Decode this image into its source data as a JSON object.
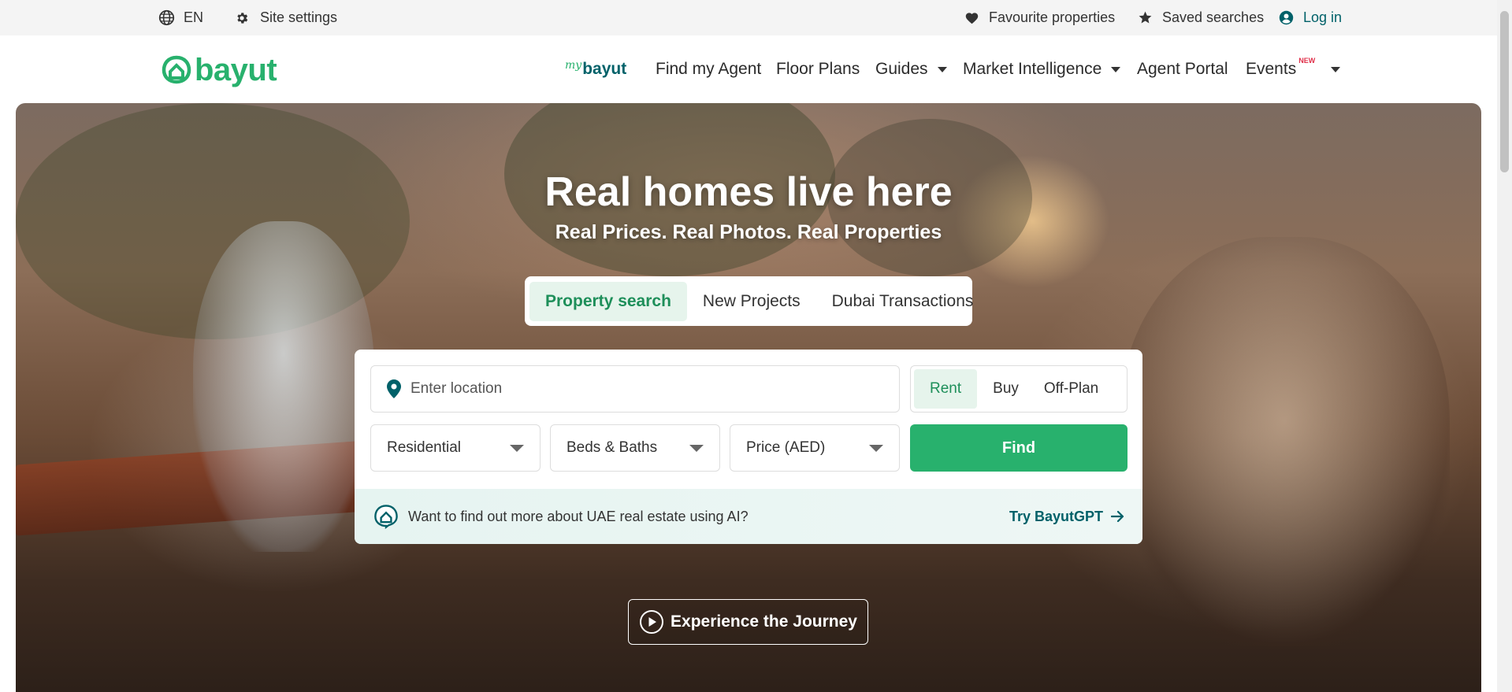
{
  "topbar": {
    "language": "EN",
    "site_settings": "Site settings",
    "favourites": "Favourite properties",
    "saved_searches": "Saved searches",
    "login": "Log in"
  },
  "nav": {
    "logo": "bayut",
    "mybayut_prefix": "my",
    "mybayut": "bayut",
    "find_agent": "Find my Agent",
    "floor_plans": "Floor Plans",
    "guides": "Guides",
    "market_intelligence": "Market Intelligence",
    "agent_portal": "Agent Portal",
    "events": "Events",
    "events_badge": "NEW"
  },
  "hero": {
    "title": "Real homes live here",
    "subtitle": "Real Prices. Real Photos. Real Properties",
    "tabs": [
      {
        "label": "Property search",
        "active": true
      },
      {
        "label": "New Projects",
        "active": false
      },
      {
        "label": "Dubai Transactions",
        "active": false
      }
    ],
    "search": {
      "location_placeholder": "Enter location",
      "purpose": [
        "Rent",
        "Buy",
        "Off-Plan"
      ],
      "purpose_selected": "Rent",
      "property_type": "Residential",
      "beds_baths": "Beds & Baths",
      "price": "Price (AED)",
      "find": "Find"
    },
    "ai_prompt": "Want to find out more about UAE real estate using AI?",
    "ai_link": "Try BayutGPT",
    "journey": "Experience the Journey"
  },
  "colors": {
    "brand_green": "#28b16d",
    "teal": "#006169",
    "active_tab_bg": "#e6f4ec"
  }
}
